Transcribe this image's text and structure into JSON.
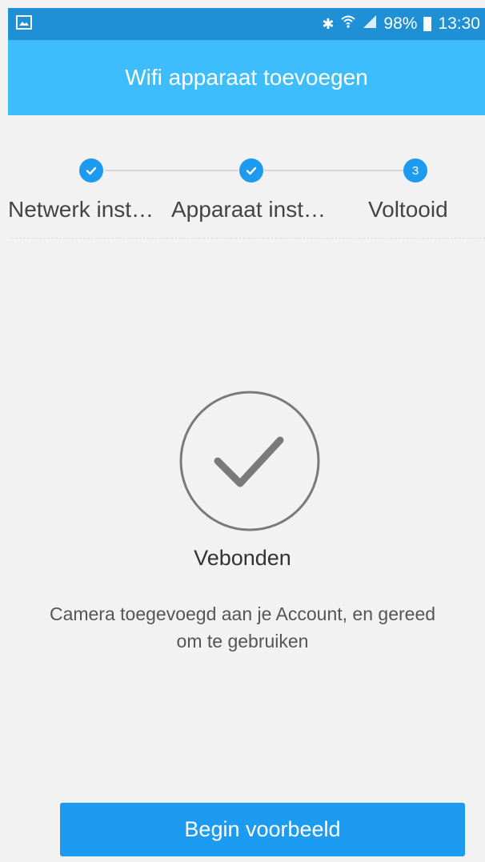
{
  "status_bar": {
    "battery": "98%",
    "time": "13:30",
    "icons": [
      "image-icon",
      "bluetooth-icon",
      "wifi-icon",
      "signal-icon",
      "battery-icon"
    ]
  },
  "header": {
    "title": "Wifi apparaat toevoegen"
  },
  "steps": [
    {
      "label": "Netwerk inst…",
      "state": "completed"
    },
    {
      "label": "Apparaat inst…",
      "state": "completed"
    },
    {
      "label": "Voltooid",
      "number": "3",
      "state": "current"
    }
  ],
  "result": {
    "title": "Vebonden",
    "description": "Camera toegevoegd aan je Account, en gereed om te gebruiken"
  },
  "actions": {
    "primary": "Begin voorbeeld"
  },
  "colors": {
    "status_bar": "#1f8fd6",
    "header": "#3ebdfd",
    "accent": "#1d9bf0",
    "background": "#f2f2f2"
  }
}
